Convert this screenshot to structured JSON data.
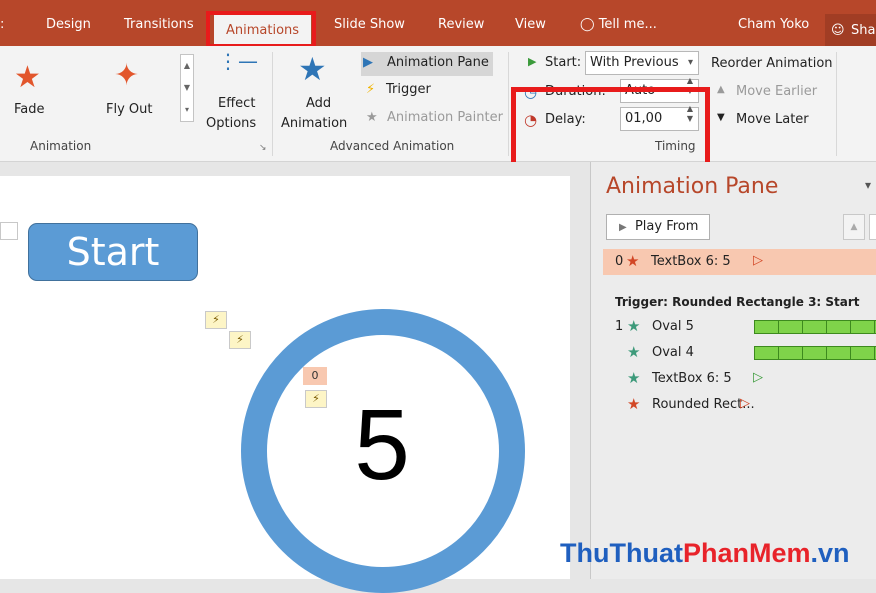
{
  "tabs": [
    {
      "label": "Design"
    },
    {
      "label": "Transitions"
    },
    {
      "label": "Animations"
    },
    {
      "label": "Slide Show"
    },
    {
      "label": "Review"
    },
    {
      "label": "View"
    }
  ],
  "tell_me": "Tell me...",
  "user_name": "Cham Yoko",
  "share_label": "Sha",
  "ribbon": {
    "animation_group": {
      "items": [
        "Fade",
        "Fly Out"
      ],
      "effect_options": [
        "Effect",
        "Options"
      ],
      "label": "Animation"
    },
    "advanced_group": {
      "add_animation": [
        "Add",
        "Animation"
      ],
      "animation_pane": "Animation Pane",
      "trigger": "Trigger",
      "animation_painter": "Animation Painter",
      "label": "Advanced Animation"
    },
    "timing_group": {
      "start_label": "Start:",
      "start_value": "With Previous",
      "duration_label": "Duration:",
      "duration_value": "Auto",
      "delay_label": "Delay:",
      "delay_value": "01,00",
      "label": "Timing",
      "reorder": "Reorder Animation",
      "move_earlier": "Move Earlier",
      "move_later": "Move Later"
    }
  },
  "slide": {
    "start_button": "Start",
    "big_number": "5",
    "tag": "0"
  },
  "pane": {
    "title": "Animation Pane",
    "play_from": "Play From",
    "selected": {
      "index": "0",
      "name": "TextBox 6: 5"
    },
    "trigger_header": "Trigger: Rounded Rectangle 3: Start",
    "items": [
      {
        "index": "1",
        "name": "Oval 5"
      },
      {
        "index": "",
        "name": "Oval 4"
      },
      {
        "index": "",
        "name": "TextBox 6: 5"
      },
      {
        "index": "",
        "name": "Rounded Rect..."
      }
    ]
  },
  "watermark": {
    "part1": "ThuThuat",
    "part2": "PhanMem",
    "part3": ".vn"
  },
  "colors": {
    "accent": "#b7472a",
    "highlight": "#e81b1b",
    "shape_blue": "#5b9bd5",
    "bar_green": "#7fd34a"
  }
}
